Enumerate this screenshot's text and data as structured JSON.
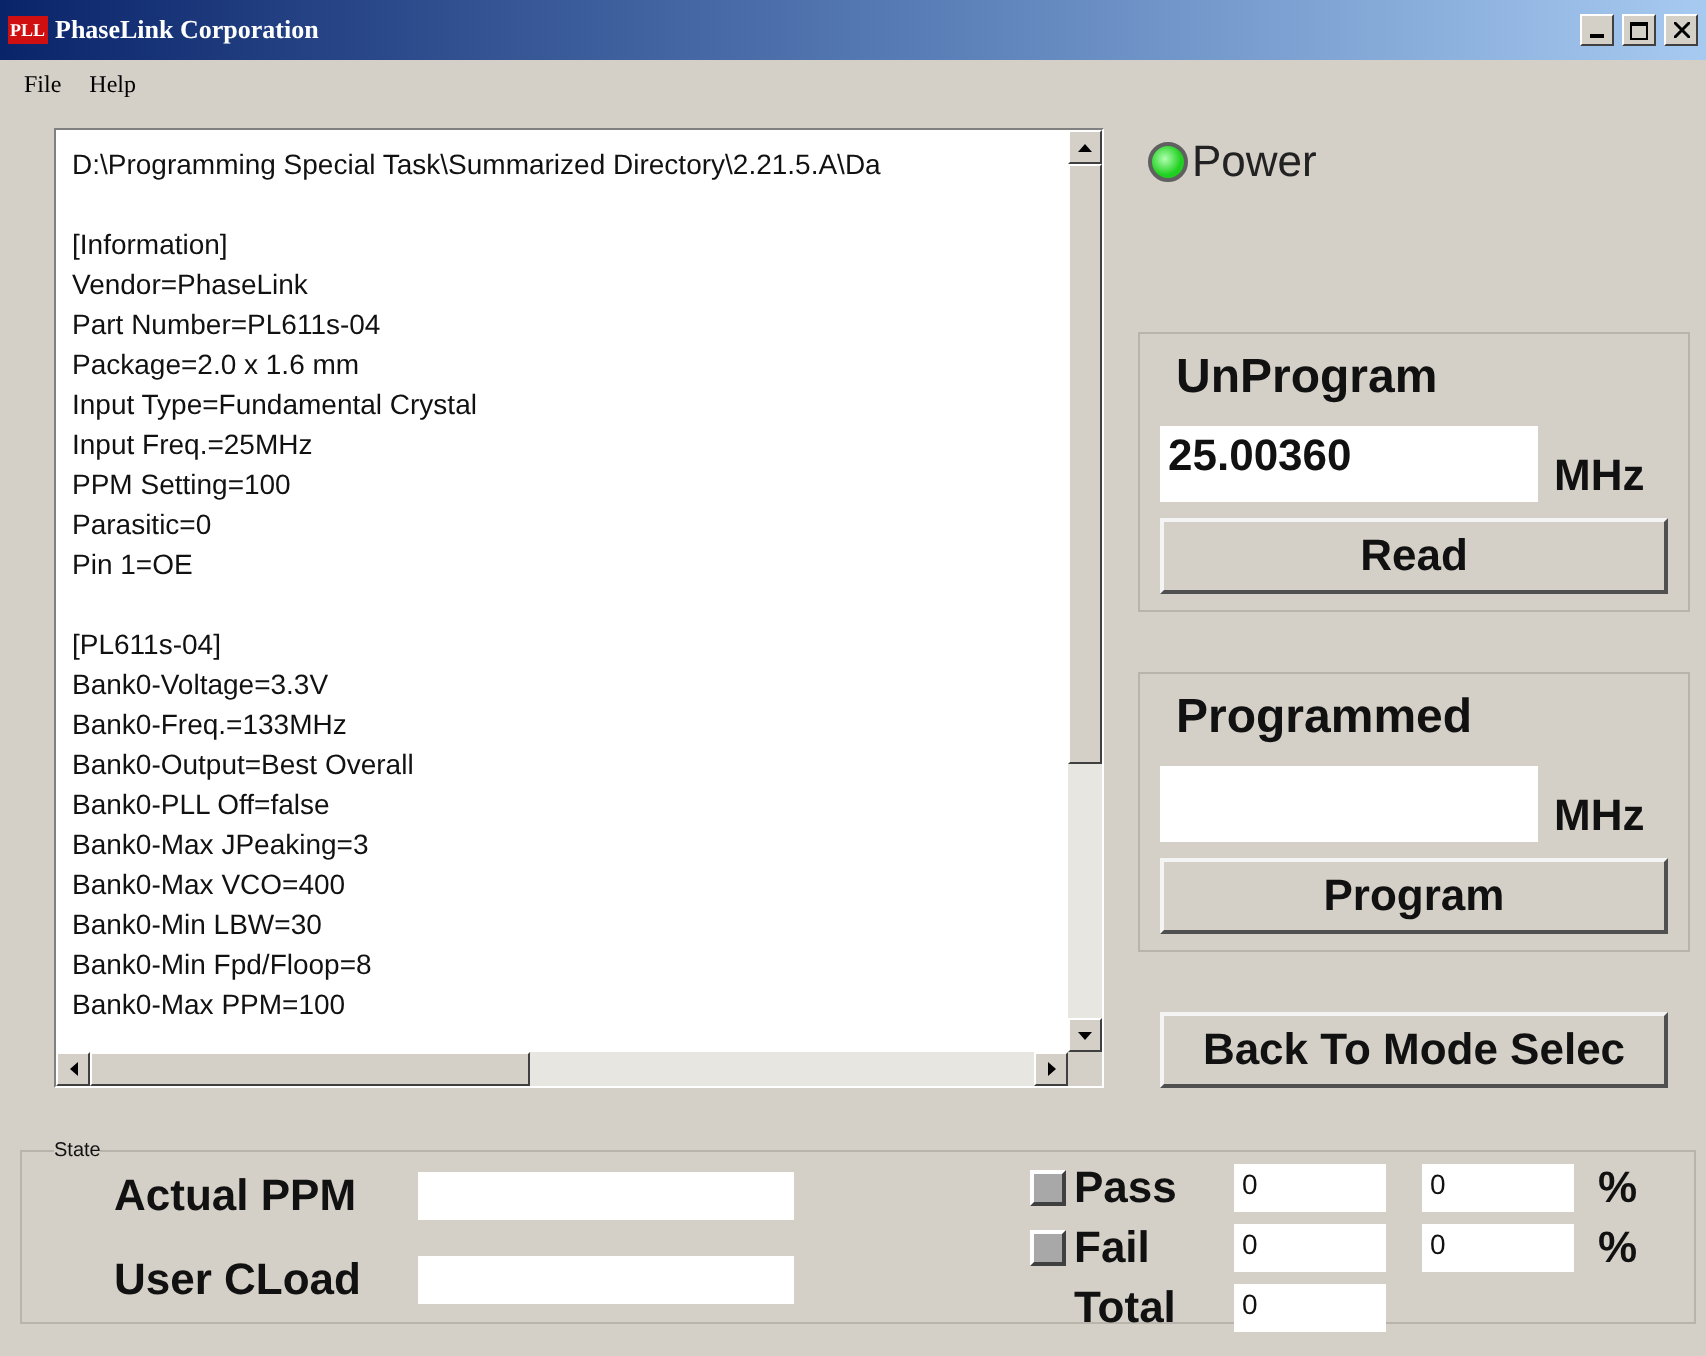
{
  "window": {
    "title": "PhaseLink Corporation",
    "logo": "PLL"
  },
  "menu": [
    "File",
    "Help"
  ],
  "listing": {
    "path": "D:\\Programming Special Task\\Summarized Directory\\2.21.5.A\\Da",
    "sections": [
      {
        "lines": [
          "[Information]",
          "Vendor=PhaseLink",
          "Part Number=PL611s-04",
          "Package=2.0 x 1.6 mm",
          "Input Type=Fundamental Crystal",
          "Input Freq.=25MHz",
          "PPM Setting=100",
          "Parasitic=0",
          "Pin 1=OE"
        ]
      },
      {
        "lines": [
          "[PL611s-04]",
          "Bank0-Voltage=3.3V",
          "Bank0-Freq.=133MHz",
          "Bank0-Output=Best Overall",
          "Bank0-PLL Off=false",
          "Bank0-Max JPeaking=3",
          "Bank0-Max VCO=400",
          "Bank0-Min LBW=30",
          "Bank0-Min Fpd/Floop=8",
          "Bank0-Max PPM=100"
        ]
      }
    ]
  },
  "power": {
    "label": "Power",
    "lit": true
  },
  "groups": [
    {
      "title": "UnProgram",
      "value": "25.00360",
      "unit": "MHz",
      "button": "Read"
    },
    {
      "title": "Programmed",
      "unit": "MHz",
      "button": "Program"
    }
  ],
  "back_button": "Back To Mode Selec",
  "state": {
    "title": "State",
    "fields": [
      {
        "label": "Actual PPM"
      },
      {
        "label": "User CLoad"
      }
    ],
    "counters": [
      {
        "label": "Pass",
        "lit": false,
        "count": "0",
        "percent": "0",
        "unit": "%"
      },
      {
        "label": "Fail",
        "lit": false,
        "count": "0",
        "percent": "0",
        "unit": "%"
      },
      {
        "label": "Total",
        "count": "0"
      }
    ]
  }
}
